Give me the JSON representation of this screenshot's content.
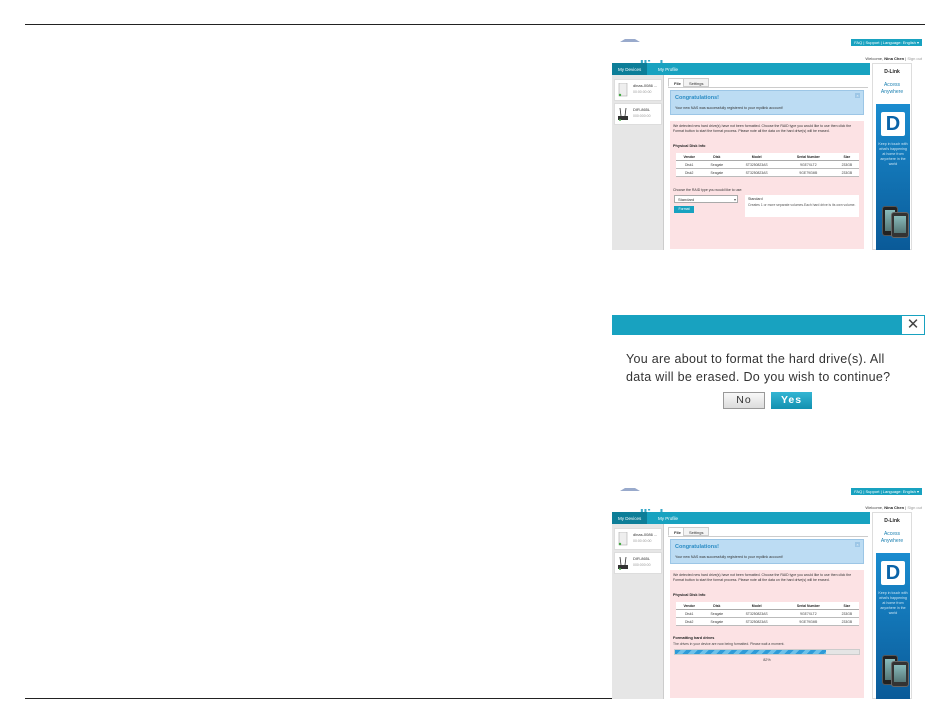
{
  "common": {
    "logo": {
      "my": "my",
      "dlink": "dlink"
    },
    "top_links": "FAQ | Support | Language: English ▾",
    "welcome_prefix": "Welcome,",
    "user_name": "Nina Chen",
    "sign_out": "Sign out",
    "nav": [
      "My Devices",
      "My Profile"
    ],
    "devices": [
      {
        "name": "dlnas-0086 ...",
        "sub": "00:00:00:00"
      },
      {
        "name": "DIR-865L",
        "sub": "000:000:00"
      }
    ],
    "tabs": [
      "File",
      "Settings"
    ],
    "congrats_title": "Congratulations!",
    "congrats_body": "Your new NAS was successfully registered to your mydlink account!",
    "close_glyph": "×",
    "detect_text": "We detected new hard drive(s) have not been formatted. Choose the RAID type you would like to use then click the Format button to start the format process. Please note all the data on the hard drive(s) will be erased.",
    "physical_label": "Physical Disk Info",
    "table": {
      "headers": [
        "Vendor",
        "Disk",
        "Model",
        "Serial Number",
        "Size"
      ],
      "rows": [
        [
          "Disk1",
          "Seagate",
          "ST3250823AS",
          "9GE7XLT2",
          "233GB"
        ],
        [
          "Disk2",
          "Seagate",
          "ST3250823AS",
          "9GE79GM5",
          "233GB"
        ]
      ]
    },
    "ad": {
      "brand": "D-Link",
      "tagline_1": "Access",
      "tagline_2": "Anywhere",
      "d_glyph": "D",
      "body": "Keep in touch with what's happening at home from anywhere in the world"
    },
    "colors": {
      "accent": "#18a2c0",
      "pink": "#fce2e4",
      "congrats": "#bcdcf3"
    }
  },
  "shot1": {
    "choose_label": "Choose the RAID type you would like to use:",
    "raid_selected": "Standard",
    "dropdown_glyph": "▾",
    "format_button": "Format",
    "standard_title": "Standard",
    "standard_desc": "Creates 1 or more separate volumes.Each hard drive is its own volume."
  },
  "dialog": {
    "close_glyph": "✕",
    "message": "You are about to format the hard drive(s). All data will be erased. Do you wish to continue?",
    "no": "No",
    "yes": "Yes"
  },
  "shot3": {
    "formatting_label": "Formatting hard drives",
    "formatting_note": "The drives in your device are now being formatted. Please wait a moment.",
    "progress_fraction": 0.82,
    "progress_text": "82%"
  }
}
